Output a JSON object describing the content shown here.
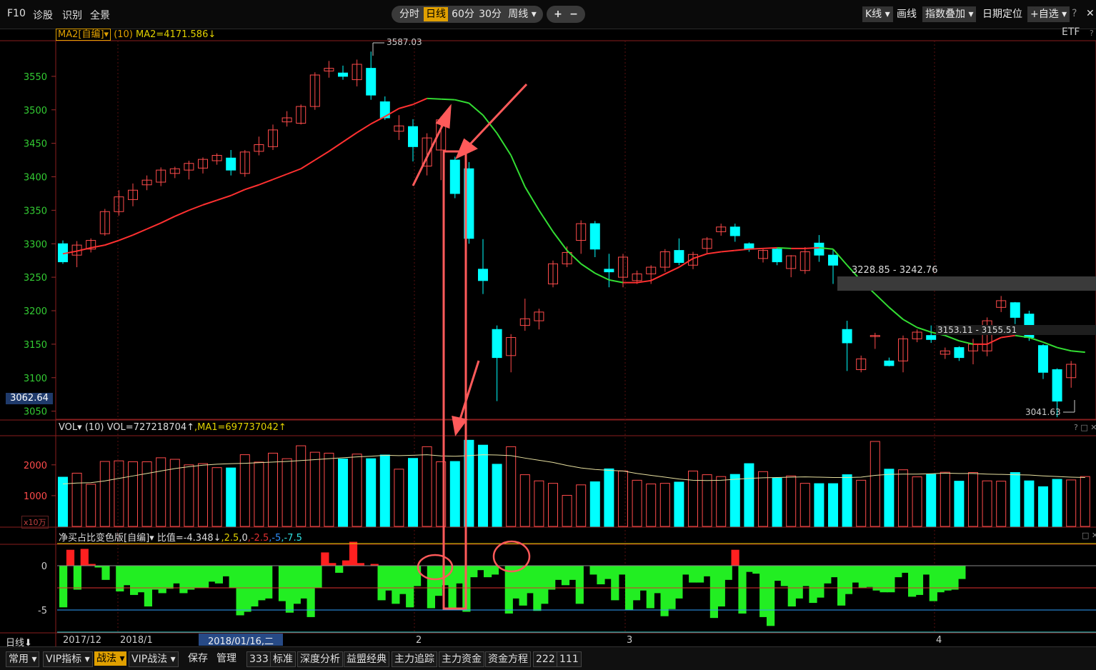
{
  "topbar": {
    "f10": "F10",
    "diagnose": "诊股",
    "identify": "识别",
    "fullview": "全景",
    "periods": [
      "分时",
      "日线",
      "60分",
      "30分",
      "周线 ▾"
    ],
    "active_period": "日线",
    "zoom_in": "+",
    "zoom_out": "−",
    "kline": "K线 ▾",
    "draw": "画线",
    "overlay": "指数叠加 ▾",
    "date_locate": "日期定位",
    "watchlist": "+自选 ▾",
    "help": "?",
    "close": "✕"
  },
  "main_panel": {
    "indicator_name": "MA2[自编]▾",
    "period": "(10)",
    "ma_label": "MA2=4171.586↓",
    "etf": "ETF",
    "q": "?",
    "price_tag": "3062.64",
    "high_label": "3587.03",
    "low_label": "3041.63",
    "range1_label": "3228.85 - 3242.76",
    "range2_label": "3153.11 - 3155.51"
  },
  "vol_panel": {
    "name": "VOL▾",
    "period": "(10)",
    "vol_label": "VOL=727218704↑",
    "ma1_label": ",MA1=697737042↑",
    "unit": "x10万",
    "ctrl": "? □ ✕"
  },
  "ind_panel": {
    "name": "净买占比变色版[自编]▾",
    "ratio": "比值=-4.348↓",
    "levels": [
      ",2.5",
      ",0",
      ",-2.5",
      ",-5",
      ",-7.5"
    ],
    "ctrl": "□ ✕"
  },
  "xaxis": {
    "mode": "日线⬇",
    "labels": [
      "2017/12",
      "2018/1",
      "2",
      "3",
      "4"
    ],
    "cursor_date": "2018/01/16,二"
  },
  "bottombar": {
    "items": [
      "常用 ▾",
      "VIP指标 ▾",
      "战法 ▾",
      "VIP战法 ▾",
      "保存",
      "管理",
      "333",
      "标准",
      "深度分析",
      "益盟经典",
      "主力追踪",
      "主力资金",
      "资金方程",
      "222",
      "111"
    ],
    "active": "战法 ▾"
  },
  "colors": {
    "up": "#ff4b4b",
    "down": "#00ffff",
    "ma_up": "#ff3030",
    "ma_down": "#33dd33",
    "axis": "#9a2a2a",
    "ylabel": "#33cc33",
    "ind_up": "#ff2020",
    "ind_down": "#22ee22",
    "annot": "#ff5a5a"
  },
  "chart_data": {
    "type": "candlestick",
    "ylim": [
      3040,
      3600
    ],
    "yticks": [
      3050,
      3100,
      3150,
      3200,
      3250,
      3300,
      3350,
      3400,
      3450,
      3500,
      3550
    ],
    "candles": [
      {
        "o": 3300,
        "c": 3273,
        "h": 3305,
        "l": 3270
      },
      {
        "o": 3283,
        "c": 3298,
        "h": 3304,
        "l": 3265
      },
      {
        "o": 3292,
        "c": 3305,
        "h": 3308,
        "l": 3287
      },
      {
        "o": 3315,
        "c": 3348,
        "h": 3352,
        "l": 3312
      },
      {
        "o": 3348,
        "c": 3370,
        "h": 3380,
        "l": 3342
      },
      {
        "o": 3366,
        "c": 3380,
        "h": 3390,
        "l": 3356
      },
      {
        "o": 3388,
        "c": 3395,
        "h": 3402,
        "l": 3380
      },
      {
        "o": 3392,
        "c": 3410,
        "h": 3414,
        "l": 3386
      },
      {
        "o": 3405,
        "c": 3412,
        "h": 3415,
        "l": 3398
      },
      {
        "o": 3410,
        "c": 3420,
        "h": 3424,
        "l": 3396
      },
      {
        "o": 3413,
        "c": 3426,
        "h": 3429,
        "l": 3405
      },
      {
        "o": 3424,
        "c": 3432,
        "h": 3435,
        "l": 3418
      },
      {
        "o": 3428,
        "c": 3410,
        "h": 3440,
        "l": 3402
      },
      {
        "o": 3405,
        "c": 3437,
        "h": 3440,
        "l": 3400
      },
      {
        "o": 3438,
        "c": 3448,
        "h": 3460,
        "l": 3432
      },
      {
        "o": 3445,
        "c": 3470,
        "h": 3478,
        "l": 3440
      },
      {
        "o": 3482,
        "c": 3488,
        "h": 3498,
        "l": 3475
      },
      {
        "o": 3480,
        "c": 3505,
        "h": 3508,
        "l": 3478
      },
      {
        "o": 3505,
        "c": 3552,
        "h": 3556,
        "l": 3500
      },
      {
        "o": 3558,
        "c": 3562,
        "h": 3573,
        "l": 3548
      },
      {
        "o": 3555,
        "c": 3550,
        "h": 3566,
        "l": 3545
      },
      {
        "o": 3545,
        "c": 3568,
        "h": 3575,
        "l": 3535
      },
      {
        "o": 3562,
        "c": 3522,
        "h": 3587,
        "l": 3515
      },
      {
        "o": 3512,
        "c": 3488,
        "h": 3520,
        "l": 3485
      },
      {
        "o": 3468,
        "c": 3476,
        "h": 3492,
        "l": 3455
      },
      {
        "o": 3475,
        "c": 3445,
        "h": 3486,
        "l": 3423
      },
      {
        "o": 3416,
        "c": 3458,
        "h": 3465,
        "l": 3402
      },
      {
        "o": 3440,
        "c": 3485,
        "h": 3490,
        "l": 3395
      },
      {
        "o": 3425,
        "c": 3375,
        "h": 3430,
        "l": 3368
      },
      {
        "o": 3412,
        "c": 3308,
        "h": 3422,
        "l": 3300
      },
      {
        "o": 3262,
        "c": 3245,
        "h": 3307,
        "l": 3225
      },
      {
        "o": 3172,
        "c": 3130,
        "h": 3178,
        "l": 3065
      },
      {
        "o": 3133,
        "c": 3160,
        "h": 3165,
        "l": 3108
      },
      {
        "o": 3178,
        "c": 3188,
        "h": 3218,
        "l": 3170
      },
      {
        "o": 3185,
        "c": 3198,
        "h": 3203,
        "l": 3172
      },
      {
        "o": 3240,
        "c": 3270,
        "h": 3275,
        "l": 3235
      },
      {
        "o": 3270,
        "c": 3287,
        "h": 3296,
        "l": 3265
      },
      {
        "o": 3305,
        "c": 3330,
        "h": 3335,
        "l": 3285
      },
      {
        "o": 3330,
        "c": 3292,
        "h": 3334,
        "l": 3280
      },
      {
        "o": 3262,
        "c": 3258,
        "h": 3285,
        "l": 3235
      },
      {
        "o": 3250,
        "c": 3280,
        "h": 3285,
        "l": 3235
      },
      {
        "o": 3245,
        "c": 3255,
        "h": 3260,
        "l": 3240
      },
      {
        "o": 3255,
        "c": 3265,
        "h": 3268,
        "l": 3240
      },
      {
        "o": 3265,
        "c": 3288,
        "h": 3292,
        "l": 3258
      },
      {
        "o": 3290,
        "c": 3272,
        "h": 3308,
        "l": 3268
      },
      {
        "o": 3268,
        "c": 3284,
        "h": 3288,
        "l": 3262
      },
      {
        "o": 3293,
        "c": 3307,
        "h": 3310,
        "l": 3285
      },
      {
        "o": 3318,
        "c": 3325,
        "h": 3330,
        "l": 3312
      },
      {
        "o": 3325,
        "c": 3312,
        "h": 3330,
        "l": 3303
      },
      {
        "o": 3300,
        "c": 3292,
        "h": 3302,
        "l": 3288
      },
      {
        "o": 3278,
        "c": 3290,
        "h": 3292,
        "l": 3272
      },
      {
        "o": 3292,
        "c": 3273,
        "h": 3294,
        "l": 3268
      },
      {
        "o": 3263,
        "c": 3282,
        "h": 3283,
        "l": 3250
      },
      {
        "o": 3260,
        "c": 3288,
        "h": 3295,
        "l": 3255
      },
      {
        "o": 3301,
        "c": 3283,
        "h": 3313,
        "l": 3273
      },
      {
        "o": 3283,
        "c": 3268,
        "h": 3292,
        "l": 3240
      },
      {
        "o": 3172,
        "c": 3152,
        "h": 3185,
        "l": 3110
      },
      {
        "o": 3112,
        "c": 3128,
        "h": 3133,
        "l": 3108
      },
      {
        "o": 3162,
        "c": 3163,
        "h": 3167,
        "l": 3143
      },
      {
        "o": 3125,
        "c": 3118,
        "h": 3130,
        "l": 3117
      },
      {
        "o": 3125,
        "c": 3158,
        "h": 3163,
        "l": 3108
      },
      {
        "o": 3158,
        "c": 3168,
        "h": 3172,
        "l": 3153
      },
      {
        "o": 3163,
        "c": 3157,
        "h": 3178,
        "l": 3152
      },
      {
        "o": 3135,
        "c": 3140,
        "h": 3145,
        "l": 3128
      },
      {
        "o": 3145,
        "c": 3130,
        "h": 3147,
        "l": 3125
      },
      {
        "o": 3140,
        "c": 3150,
        "h": 3158,
        "l": 3120
      },
      {
        "o": 3140,
        "c": 3185,
        "h": 3190,
        "l": 3132
      },
      {
        "o": 3205,
        "c": 3215,
        "h": 3222,
        "l": 3198
      },
      {
        "o": 3212,
        "c": 3190,
        "h": 3213,
        "l": 3180
      },
      {
        "o": 3195,
        "c": 3160,
        "h": 3200,
        "l": 3155
      },
      {
        "o": 3148,
        "c": 3108,
        "h": 3150,
        "l": 3098
      },
      {
        "o": 3112,
        "c": 3065,
        "h": 3114,
        "l": 3041
      },
      {
        "o": 3100,
        "c": 3120,
        "h": 3125,
        "l": 3085
      }
    ],
    "ma": [
      3285,
      3289,
      3294,
      3298,
      3305,
      3313,
      3322,
      3331,
      3341,
      3350,
      3358,
      3365,
      3372,
      3381,
      3388,
      3396,
      3404,
      3412,
      3425,
      3438,
      3452,
      3466,
      3479,
      3490,
      3502,
      3508,
      3517,
      3516,
      3515,
      3510,
      3492,
      3465,
      3432,
      3385,
      3350,
      3318,
      3290,
      3270,
      3256,
      3246,
      3242,
      3242,
      3245,
      3255,
      3265,
      3278,
      3285,
      3288,
      3290,
      3292,
      3293,
      3294,
      3293,
      3293,
      3294,
      3292,
      3268,
      3245,
      3225,
      3205,
      3187,
      3175,
      3168,
      3163,
      3155,
      3150,
      3150,
      3160,
      3163,
      3160,
      3153,
      3145,
      3140,
      3138
    ],
    "volume": [
      1600,
      1730,
      1370,
      2110,
      2130,
      2100,
      2100,
      2230,
      2180,
      2000,
      2040,
      1910,
      1900,
      2330,
      2090,
      2380,
      2200,
      2620,
      2410,
      2380,
      2190,
      2350,
      2200,
      2320,
      1860,
      2210,
      2590,
      2100,
      2110,
      2800,
      2640,
      2020,
      2590,
      1680,
      1480,
      1400,
      1010,
      1350,
      1450,
      1870,
      1800,
      1500,
      1380,
      1400,
      1440,
      1800,
      1680,
      1620,
      1690,
      2040,
      1780,
      1570,
      1640,
      1400,
      1390,
      1390,
      1680,
      1500,
      2760,
      1860,
      1840,
      1610,
      1690,
      1760,
      1470,
      1750,
      1480,
      1470,
      1750,
      1480,
      1290,
      1530,
      1510,
      1620
    ],
    "vol_ma": [
      1380,
      1410,
      1420,
      1480,
      1560,
      1640,
      1720,
      1800,
      1880,
      1940,
      1990,
      2020,
      2040,
      2050,
      2070,
      2090,
      2110,
      2140,
      2170,
      2200,
      2230,
      2260,
      2280,
      2310,
      2300,
      2310,
      2330,
      2290,
      2280,
      2300,
      2330,
      2320,
      2300,
      2220,
      2150,
      2080,
      1980,
      1900,
      1850,
      1820,
      1800,
      1720,
      1660,
      1600,
      1540,
      1500,
      1490,
      1500,
      1530,
      1560,
      1580,
      1590,
      1600,
      1610,
      1600,
      1590,
      1590,
      1600,
      1660,
      1690,
      1700,
      1700,
      1710,
      1730,
      1720,
      1720,
      1700,
      1690,
      1680,
      1670,
      1640,
      1620,
      1600,
      1590
    ],
    "ind": [
      -4.7,
      1.8,
      -2.7,
      1.9,
      0.2,
      -0.2,
      -1.6,
      0,
      -2.9,
      -2.2,
      -3.3,
      -3.0,
      -4.6,
      -2.7,
      -3.1,
      -2.6,
      -2.0,
      -3.1,
      -2.7,
      -2.5,
      -2.5,
      -1.8,
      -2.0,
      -1.2,
      -2.5,
      -5.6,
      -5.2,
      -4.6,
      -3.9,
      -3.7,
      0,
      -4.0,
      -5.3,
      -4.3,
      -3.7,
      -5.8,
      -2.5,
      1.5,
      0.3,
      -0.8,
      0.6,
      2.7,
      0.3,
      0,
      0.2,
      -3.9,
      -2.8,
      -4.3,
      -3.2,
      -4.7,
      -2.3,
      0,
      -4.8,
      -3.4,
      -2.2,
      -4.8,
      -2.0,
      -5.2,
      -1.3,
      -0.5,
      -1.3,
      -1.0,
      0,
      -5.4,
      -3.7,
      -4.5,
      -3.1,
      -5.1,
      -4.3,
      -2.7,
      -1.6,
      -2.2,
      -1.6,
      -4.3,
      0,
      -1.0,
      -2.1,
      -1.5,
      -3.9,
      -1.0,
      -5.0,
      -3.9,
      -2.8,
      -4.8,
      -3.1,
      -5.7,
      -4.9,
      -3.7,
      -1.0,
      -1.9,
      -1.9,
      -1.2,
      -5.9,
      -4.6,
      -1.6,
      1.8,
      -5.4,
      -0.7,
      -0.9,
      -5.8,
      -6.8,
      -1.7,
      -2.3,
      -4.6,
      -3.7,
      -2.3,
      -4.2,
      -3.6,
      -2.0,
      -1.3,
      -4.5,
      -3.2,
      -1.9,
      -2.5,
      -2.4,
      -2.8,
      -3.0,
      -3.0,
      -1.3,
      -0.8,
      -3.5,
      -3.3,
      -1.0,
      -4.0,
      -3.0,
      -2.8,
      -2.7,
      -1.5
    ],
    "ind_levels": [
      2.5,
      0,
      -2.5,
      -5,
      -7.5
    ]
  }
}
